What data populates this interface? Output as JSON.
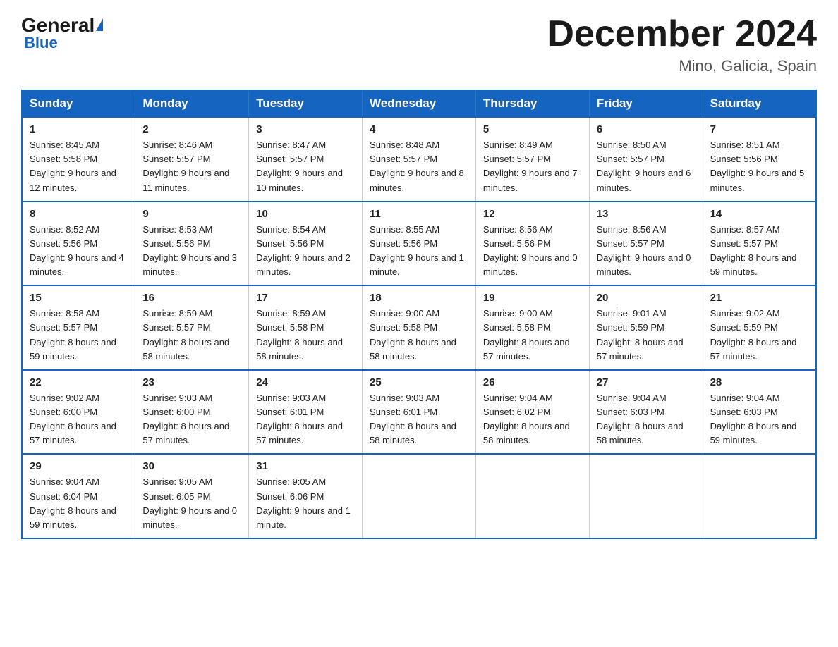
{
  "logo": {
    "general": "General",
    "blue": "Blue"
  },
  "title": "December 2024",
  "location": "Mino, Galicia, Spain",
  "days_of_week": [
    "Sunday",
    "Monday",
    "Tuesday",
    "Wednesday",
    "Thursday",
    "Friday",
    "Saturday"
  ],
  "weeks": [
    [
      {
        "day": "1",
        "sunrise": "8:45 AM",
        "sunset": "5:58 PM",
        "daylight": "9 hours and 12 minutes."
      },
      {
        "day": "2",
        "sunrise": "8:46 AM",
        "sunset": "5:57 PM",
        "daylight": "9 hours and 11 minutes."
      },
      {
        "day": "3",
        "sunrise": "8:47 AM",
        "sunset": "5:57 PM",
        "daylight": "9 hours and 10 minutes."
      },
      {
        "day": "4",
        "sunrise": "8:48 AM",
        "sunset": "5:57 PM",
        "daylight": "9 hours and 8 minutes."
      },
      {
        "day": "5",
        "sunrise": "8:49 AM",
        "sunset": "5:57 PM",
        "daylight": "9 hours and 7 minutes."
      },
      {
        "day": "6",
        "sunrise": "8:50 AM",
        "sunset": "5:57 PM",
        "daylight": "9 hours and 6 minutes."
      },
      {
        "day": "7",
        "sunrise": "8:51 AM",
        "sunset": "5:56 PM",
        "daylight": "9 hours and 5 minutes."
      }
    ],
    [
      {
        "day": "8",
        "sunrise": "8:52 AM",
        "sunset": "5:56 PM",
        "daylight": "9 hours and 4 minutes."
      },
      {
        "day": "9",
        "sunrise": "8:53 AM",
        "sunset": "5:56 PM",
        "daylight": "9 hours and 3 minutes."
      },
      {
        "day": "10",
        "sunrise": "8:54 AM",
        "sunset": "5:56 PM",
        "daylight": "9 hours and 2 minutes."
      },
      {
        "day": "11",
        "sunrise": "8:55 AM",
        "sunset": "5:56 PM",
        "daylight": "9 hours and 1 minute."
      },
      {
        "day": "12",
        "sunrise": "8:56 AM",
        "sunset": "5:56 PM",
        "daylight": "9 hours and 0 minutes."
      },
      {
        "day": "13",
        "sunrise": "8:56 AM",
        "sunset": "5:57 PM",
        "daylight": "9 hours and 0 minutes."
      },
      {
        "day": "14",
        "sunrise": "8:57 AM",
        "sunset": "5:57 PM",
        "daylight": "8 hours and 59 minutes."
      }
    ],
    [
      {
        "day": "15",
        "sunrise": "8:58 AM",
        "sunset": "5:57 PM",
        "daylight": "8 hours and 59 minutes."
      },
      {
        "day": "16",
        "sunrise": "8:59 AM",
        "sunset": "5:57 PM",
        "daylight": "8 hours and 58 minutes."
      },
      {
        "day": "17",
        "sunrise": "8:59 AM",
        "sunset": "5:58 PM",
        "daylight": "8 hours and 58 minutes."
      },
      {
        "day": "18",
        "sunrise": "9:00 AM",
        "sunset": "5:58 PM",
        "daylight": "8 hours and 58 minutes."
      },
      {
        "day": "19",
        "sunrise": "9:00 AM",
        "sunset": "5:58 PM",
        "daylight": "8 hours and 57 minutes."
      },
      {
        "day": "20",
        "sunrise": "9:01 AM",
        "sunset": "5:59 PM",
        "daylight": "8 hours and 57 minutes."
      },
      {
        "day": "21",
        "sunrise": "9:02 AM",
        "sunset": "5:59 PM",
        "daylight": "8 hours and 57 minutes."
      }
    ],
    [
      {
        "day": "22",
        "sunrise": "9:02 AM",
        "sunset": "6:00 PM",
        "daylight": "8 hours and 57 minutes."
      },
      {
        "day": "23",
        "sunrise": "9:03 AM",
        "sunset": "6:00 PM",
        "daylight": "8 hours and 57 minutes."
      },
      {
        "day": "24",
        "sunrise": "9:03 AM",
        "sunset": "6:01 PM",
        "daylight": "8 hours and 57 minutes."
      },
      {
        "day": "25",
        "sunrise": "9:03 AM",
        "sunset": "6:01 PM",
        "daylight": "8 hours and 58 minutes."
      },
      {
        "day": "26",
        "sunrise": "9:04 AM",
        "sunset": "6:02 PM",
        "daylight": "8 hours and 58 minutes."
      },
      {
        "day": "27",
        "sunrise": "9:04 AM",
        "sunset": "6:03 PM",
        "daylight": "8 hours and 58 minutes."
      },
      {
        "day": "28",
        "sunrise": "9:04 AM",
        "sunset": "6:03 PM",
        "daylight": "8 hours and 59 minutes."
      }
    ],
    [
      {
        "day": "29",
        "sunrise": "9:04 AM",
        "sunset": "6:04 PM",
        "daylight": "8 hours and 59 minutes."
      },
      {
        "day": "30",
        "sunrise": "9:05 AM",
        "sunset": "6:05 PM",
        "daylight": "9 hours and 0 minutes."
      },
      {
        "day": "31",
        "sunrise": "9:05 AM",
        "sunset": "6:06 PM",
        "daylight": "9 hours and 1 minute."
      },
      null,
      null,
      null,
      null
    ]
  ]
}
